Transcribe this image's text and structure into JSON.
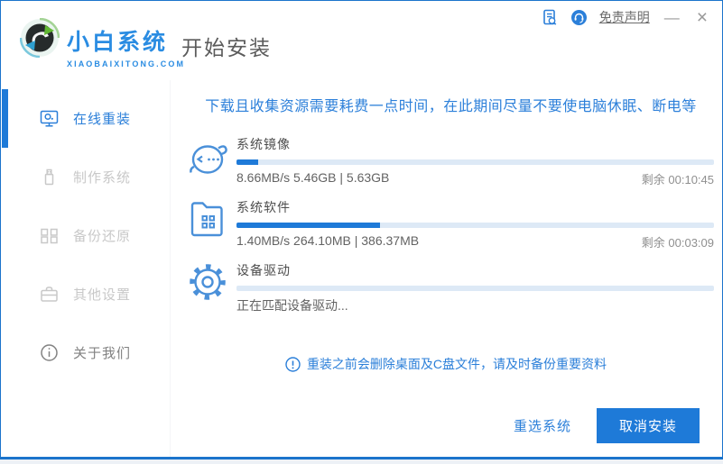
{
  "titlebar": {
    "brand_name": "小白系统",
    "brand_domain": "XIAOBAIXITONG.COM",
    "page_title": "开始安装",
    "disclaimer_link": "免责声明",
    "minimize_glyph": "—",
    "close_glyph": "×",
    "icons": [
      "license-doc-icon",
      "customer-service-icon"
    ]
  },
  "sidebar": {
    "items": [
      {
        "label": "在线重装",
        "icon": "online-reinstall-icon",
        "active": true
      },
      {
        "label": "制作系统",
        "icon": "usb-make-system-icon",
        "active": false
      },
      {
        "label": "备份还原",
        "icon": "backup-restore-icon",
        "active": false
      },
      {
        "label": "其他设置",
        "icon": "other-settings-icon",
        "active": false
      },
      {
        "label": "关于我们",
        "icon": "about-us-icon",
        "active": false
      }
    ]
  },
  "main": {
    "notice": "下载且收集资源需要耗费一点时间，在此期间尽量不要使电脑休眠、断电等",
    "tasks": [
      {
        "title": "系统镜像",
        "icon": "mascot-face-icon",
        "percent": 4.5,
        "detail": "8.66MB/s 5.46GB | 5.63GB",
        "remaining": "剩余 00:10:45"
      },
      {
        "title": "系统软件",
        "icon": "folder-grid-icon",
        "percent": 30,
        "detail": "1.40MB/s 264.10MB | 386.37MB",
        "remaining": "剩余 00:03:09"
      },
      {
        "title": "设备驱动",
        "icon": "gear-icon",
        "percent": 0,
        "detail": "正在匹配设备驱动...",
        "remaining": ""
      }
    ],
    "warning_note": "重装之前会删除桌面及C盘文件，请及时备份重要资料"
  },
  "footer": {
    "reselect_label": "重选系统",
    "cancel_label": "取消安装"
  },
  "colors": {
    "accent_blue": "#1e7ad8",
    "link_blue": "#2b7fd9",
    "brand_blue": "#2a8ce2",
    "progress_track": "#dde9f6",
    "inactive_gray": "#c8c8c8",
    "window_border": "#1b74cc"
  }
}
